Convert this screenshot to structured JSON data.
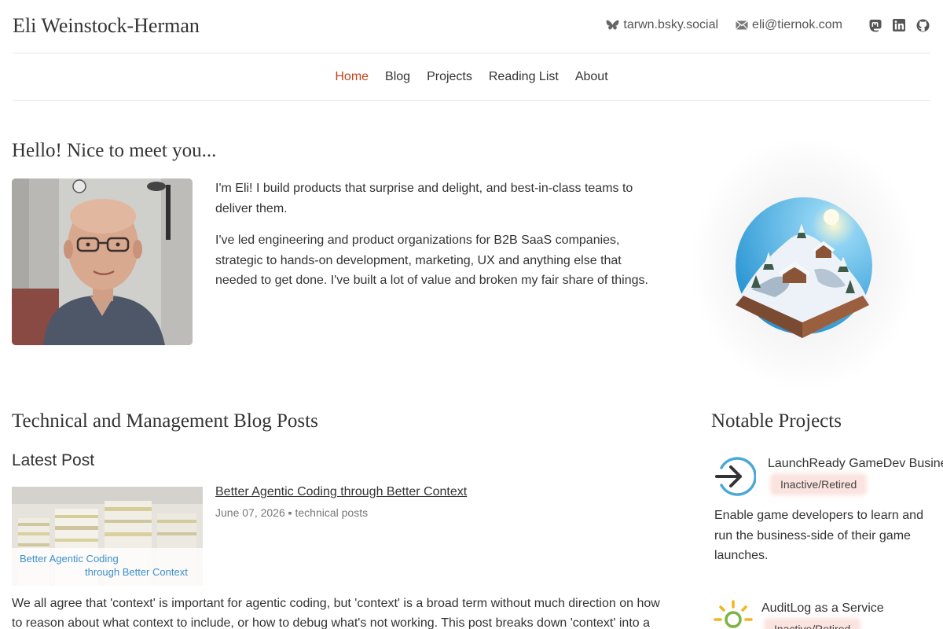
{
  "site": {
    "title": "Eli Weinstock-Herman"
  },
  "contacts": {
    "bluesky": {
      "label": "tarwn.bsky.social",
      "icon": "butterfly-icon"
    },
    "email": {
      "label": "eli@tiernok.com",
      "icon": "mail-icon"
    },
    "social_icons": [
      "mastodon-icon",
      "linkedin-icon",
      "github-icon"
    ]
  },
  "nav": {
    "items": [
      {
        "label": "Home",
        "active": true
      },
      {
        "label": "Blog"
      },
      {
        "label": "Projects"
      },
      {
        "label": "Reading List"
      },
      {
        "label": "About"
      }
    ]
  },
  "intro": {
    "heading": "Hello! Nice to meet you...",
    "paragraphs": [
      "I'm Eli! I build products that surprise and delight, and best-in-class teams to deliver them.",
      "I've led engineering and product organizations for B2B SaaS companies, strategic to hands-on development, marketing, UX and anything else that needed to get done. I've built a lot of value and broken my fair share of things."
    ]
  },
  "blog": {
    "heading": "Technical and Management Blog Posts",
    "latest_heading": "Latest Post",
    "latest": {
      "title": "Better Agentic Coding through Better Context",
      "date": "June 07, 2026",
      "separator": "▪",
      "category": "technical posts",
      "thumbnail_caption_line1": "Better Agentic Coding",
      "thumbnail_caption_line2": "through Better Context",
      "excerpt": "We all agree that 'context' is important for agentic coding, but 'context' is a broad term without much direction on how to reason about what context to include, or how to debug what's not working. This post breaks down 'context' into a"
    }
  },
  "projects": {
    "heading": "Notable Projects",
    "items": [
      {
        "name": "LaunchReady GameDev Business",
        "status": "Inactive/Retired",
        "description": "Enable game developers to learn and run the business-side of their game launches.",
        "icon": "arrow-circle-icon"
      },
      {
        "name": "AuditLog as a Service",
        "status": "Inactive/Retired",
        "icon": "sun-icon"
      }
    ]
  },
  "colors": {
    "accent": "#c0451b",
    "badge_bg": "#fbe4df",
    "caption_blue": "#3d8fc9"
  }
}
